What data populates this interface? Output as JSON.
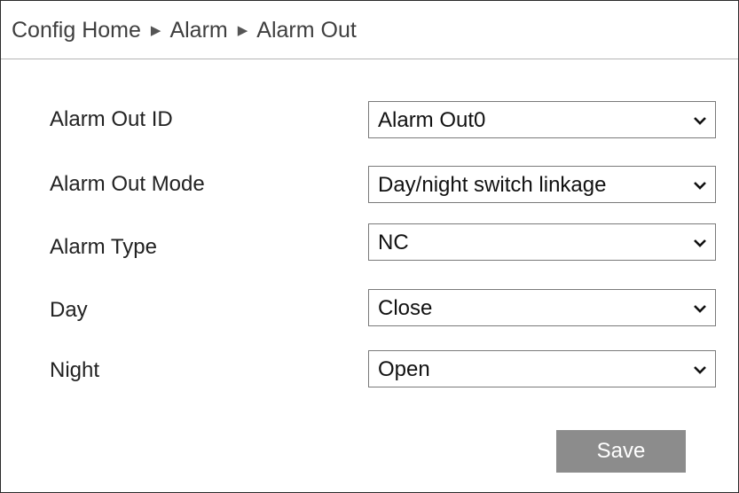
{
  "breadcrumb": {
    "items": [
      "Config Home",
      "Alarm",
      "Alarm Out"
    ],
    "separator": "▶"
  },
  "form": {
    "rows": [
      {
        "label": "Alarm Out ID",
        "value": "Alarm Out0"
      },
      {
        "label": "Alarm Out Mode",
        "value": "Day/night switch linkage"
      },
      {
        "label": "Alarm Type",
        "value": "NC"
      },
      {
        "label": "Day",
        "value": "Close"
      },
      {
        "label": "Night",
        "value": "Open"
      }
    ]
  },
  "actions": {
    "save_label": "Save"
  },
  "colors": {
    "save_button_bg": "#8c8c8c",
    "border": "#7a7a7a"
  }
}
